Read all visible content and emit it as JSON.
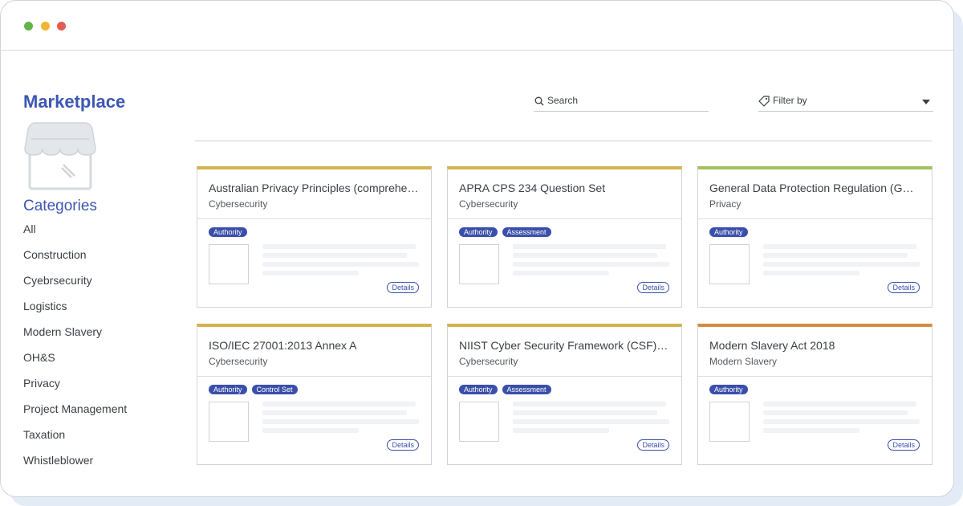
{
  "window": {
    "controls": [
      "close",
      "minimize",
      "maximize"
    ]
  },
  "sidebar": {
    "title": "Marketplace",
    "categories_title": "Categories",
    "categories": [
      "All",
      "Construction",
      "Cyebrsecurity",
      "Logistics",
      "Modern Slavery",
      "OH&S",
      "Privacy",
      "Project Management",
      "Taxation",
      "Whistleblower"
    ]
  },
  "search": {
    "placeholder": "Search"
  },
  "filter": {
    "placeholder": "Filter by"
  },
  "cards": [
    {
      "title": "Australian Privacy Principles (comprehen...",
      "category": "Cybersecurity",
      "tags": [
        "Authority"
      ],
      "details": "Details",
      "accent": "#d4b34d"
    },
    {
      "title": "APRA CPS 234 Question Set",
      "category": "Cybersecurity",
      "tags": [
        "Authority",
        "Assessment"
      ],
      "details": "Details",
      "accent": "#d4b34d"
    },
    {
      "title": "General Data Protection Regulation (GDPR...",
      "category": "Privacy",
      "tags": [
        "Authority"
      ],
      "details": "Details",
      "accent": "#a3c25c"
    },
    {
      "title": "ISO/IEC 27001:2013 Annex A",
      "category": "Cybersecurity",
      "tags": [
        "Authority",
        "Control Set"
      ],
      "details": "Details",
      "accent": "#d4b34d"
    },
    {
      "title": "NIIST Cyber Security Framework (CSF) Qu...",
      "category": "Cybersecurity",
      "tags": [
        "Authority",
        "Assessment"
      ],
      "details": "Details",
      "accent": "#d4b34d"
    },
    {
      "title": "Modern Slavery Act 2018",
      "category": "Modern Slavery",
      "tags": [
        "Authority"
      ],
      "details": "Details",
      "accent": "#d28e3e"
    }
  ],
  "colors": {
    "brand": "#3c57b4",
    "tag": "#3a4faa"
  }
}
